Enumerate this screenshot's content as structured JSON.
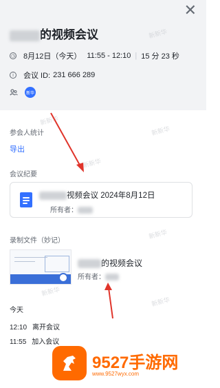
{
  "meeting": {
    "title_suffix": "的视频会议",
    "date": "8月12日（今天）",
    "time_range": "11:55 - 12:10",
    "duration": "15 分 23 秒",
    "meeting_id_label": "会议 ID:",
    "meeting_id": "231 666 289",
    "participant_avatar": "新华"
  },
  "stats": {
    "label": "参会人统计",
    "export": "导出"
  },
  "minutes": {
    "label": "会议纪要",
    "doc_title": "视频会议 2024年8月12日",
    "owner_label": "所有者："
  },
  "recording": {
    "label": "录制文件（妙记）",
    "title": "的视频会议",
    "owner_label": "所有者："
  },
  "timeline": {
    "day": "今天",
    "events": [
      {
        "time": "12:10",
        "text": "离开会议"
      },
      {
        "time": "11:55",
        "text": "加入会议"
      }
    ]
  },
  "watermark": "新新华",
  "brand": {
    "name": "9527手游网",
    "url": "www.9527wyx.com"
  }
}
